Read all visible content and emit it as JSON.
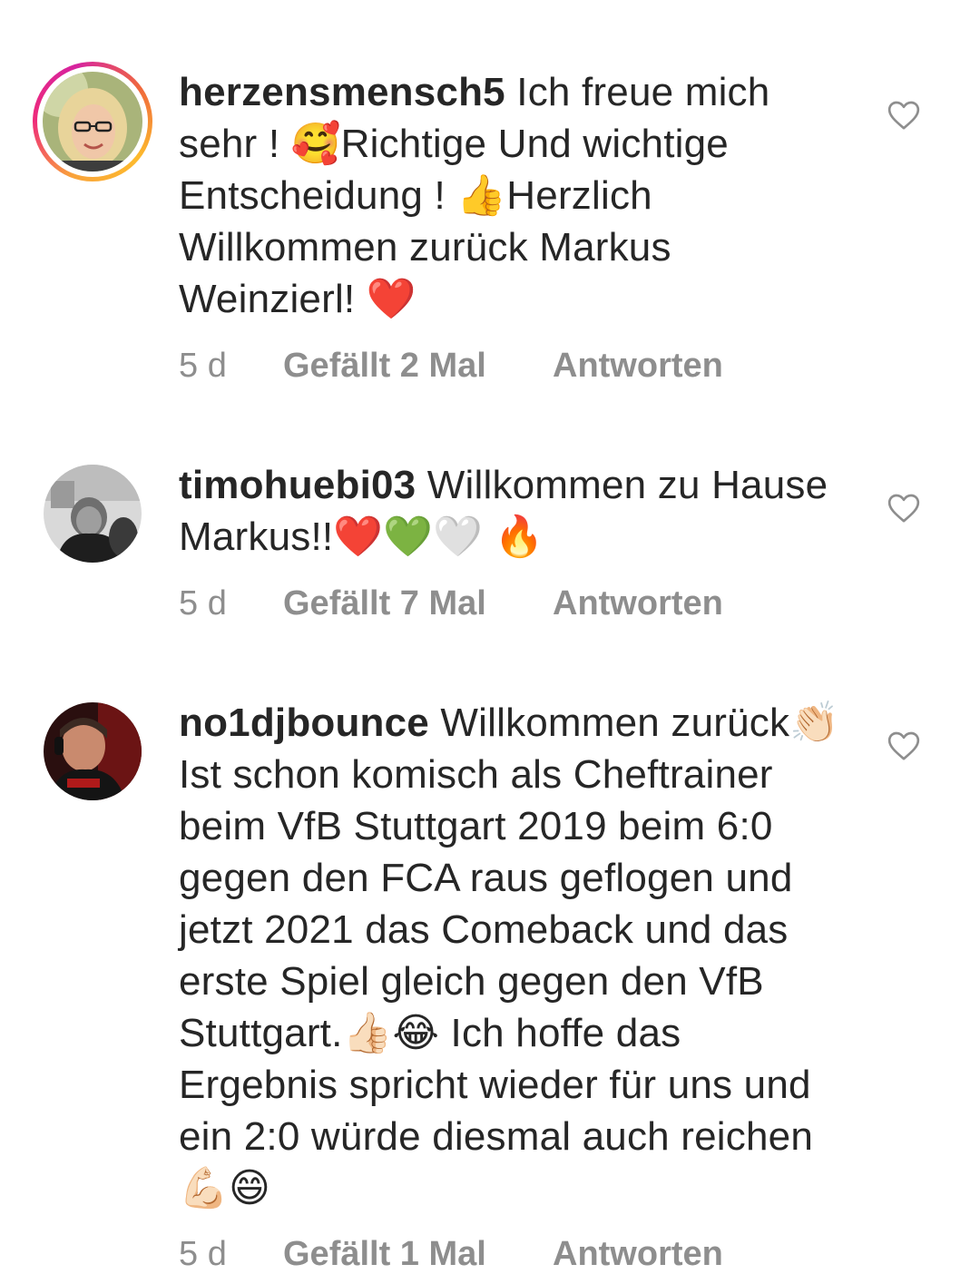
{
  "comments": [
    {
      "username": "herzensmensch5",
      "text": " Ich freue mich sehr ! 🥰Richtige Und wichtige Entscheidung ! 👍Herzlich Willkommen zurück Markus Weinzierl! ❤️",
      "time": "5 d",
      "likes": "Gefällt 2 Mal",
      "reply": "Antworten",
      "has_story": true
    },
    {
      "username": "timohuebi03",
      "text": " Willkommen zu Hause Markus!!❤️💚🤍 🔥",
      "time": "5 d",
      "likes": "Gefällt 7 Mal",
      "reply": "Antworten",
      "has_story": false
    },
    {
      "username": "no1djbounce",
      "text": " Willkommen zurück👏🏻 Ist schon komisch als Cheftrainer beim VfB Stuttgart 2019 beim 6:0 gegen den FCA raus geflogen und jetzt 2021 das Comeback und das erste Spiel gleich gegen den VfB Stuttgart.👍🏻😂 Ich hoffe das Ergebnis spricht wieder für uns und ein 2:0 würde diesmal auch reichen💪🏻😄",
      "time": "5 d",
      "likes": "Gefällt 1 Mal",
      "reply": "Antworten",
      "has_story": false
    }
  ],
  "icons": {
    "like": "heart-outline-icon"
  },
  "colors": {
    "text": "#262626",
    "meta": "#8e8e8e",
    "heart_outline": "#8e8e8e"
  }
}
